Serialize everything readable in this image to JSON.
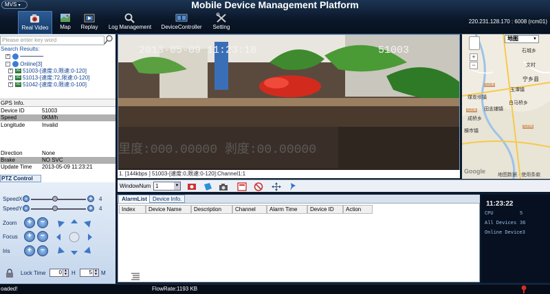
{
  "window": {
    "mvs_label": "MVS",
    "app_title": "Mobile Device Management Platform",
    "server_info": "220.231.128.170 : 6008 (rcm01)"
  },
  "nav": [
    {
      "label": "Real Video",
      "icon": "camera-icon",
      "active": true
    },
    {
      "label": "Map",
      "icon": "map-icon"
    },
    {
      "label": "Replay",
      "icon": "replay-icon"
    },
    {
      "label": "Log Management",
      "icon": "log-search-icon"
    },
    {
      "label": "DeviceController",
      "icon": "controller-icon"
    },
    {
      "label": "Setting",
      "icon": "settings-icon"
    }
  ],
  "search": {
    "placeholder": "Please enter key word",
    "results_label": "Search Results:"
  },
  "tree": {
    "online_label": "Online[3]",
    "devices": [
      "51003-[速度:0,限速:0-120]",
      "51013-[速度:72,限速:0-120]",
      "51042-[速度:0,限速:0-100]"
    ]
  },
  "gps": {
    "header": "GPS Info.",
    "rows": [
      {
        "key": "Device ID",
        "value": "51003"
      },
      {
        "key": "Speed",
        "value": "0KM/h"
      },
      {
        "key": "Longitude",
        "value": "Invalid"
      },
      {
        "key": "Direction",
        "value": "None"
      },
      {
        "key": "Brake",
        "value": "NO SVC"
      },
      {
        "key": "Update Time",
        "value": "2013-05-09 11:23:21"
      }
    ]
  },
  "ptz": {
    "tab_label": "PTZ Control",
    "speed_x_label": "SpeedX",
    "speed_x_value": "4",
    "speed_y_label": "SpeedY",
    "speed_y_value": "4",
    "zoom_label": "Zoom",
    "focus_label": "Focus",
    "iris_label": "Iris",
    "lock_time_label": "Lock Time",
    "lock_hours": "0",
    "hours_unit": "H",
    "lock_minutes": "5",
    "minutes_unit": "M"
  },
  "video": {
    "timestamp": "2013-05-09  11:23:18",
    "channel_id": "51003",
    "caption": "1. [144kbps ] 51003-[速度:0,限速:0-120]:Channel1:1"
  },
  "map": {
    "type_label": "地图",
    "places": [
      "石城乡",
      "文村",
      "宁乡县",
      "玉潭镇",
      "煤炭坝镇",
      "白马桥乡",
      "田志铺镇",
      "成桥乡",
      "横市镇"
    ],
    "road_labels": [
      "S208",
      "S206",
      "S206"
    ],
    "copyright": "地图数据 · 使用条款",
    "logo": "Google"
  },
  "toolbar": {
    "window_num_label": "WindowNum",
    "window_num_value": "1"
  },
  "alarm": {
    "tabs": [
      "AlarmList",
      "Device Info."
    ],
    "columns": [
      "Index",
      "Device Name",
      "Description",
      "Channel",
      "Alarm Time",
      "Device ID",
      "Action"
    ]
  },
  "info": {
    "clock": "11:23:22",
    "cpu_label": "CPU",
    "cpu_value": "5",
    "all_devices_label": "All Devices",
    "all_devices_value": "36",
    "online_devices": "Online Device3"
  },
  "status": {
    "left_text": "oaded!",
    "flow_rate": "FlowRate:1193 KB"
  }
}
